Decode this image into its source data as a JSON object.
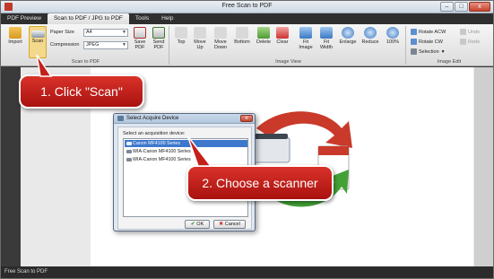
{
  "window": {
    "title": "Free Scan to PDF",
    "buttons": {
      "minimize": "–",
      "maximize": "□",
      "close": "x"
    }
  },
  "tabs": [
    {
      "label": "PDF Preview",
      "active": false
    },
    {
      "label": "Scan to PDF / JPG to PDF",
      "active": true
    },
    {
      "label": "Tools",
      "active": false
    },
    {
      "label": "Help",
      "active": false
    }
  ],
  "ribbon": {
    "scan_group": {
      "label": "Scan to PDF",
      "import_label": "Import",
      "scan_label": "Scan",
      "paper_size_label": "Paper Size",
      "paper_size_value": "A4",
      "compression_label": "Compression",
      "compression_value": "JPEG",
      "save_pdf_label": "Save PDF",
      "send_pdf_label": "Send PDF"
    },
    "image_view_group": {
      "label": "Image View",
      "top": "Top",
      "move_up": "Move Up",
      "move_down": "Move Down",
      "bottom": "Bottom",
      "delete": "Delete",
      "clear": "Clear",
      "fit_image": "Fit Image",
      "fit_width": "Fit Width",
      "enlarge": "Enlarge",
      "reduce": "Reduce",
      "percent": "100%"
    },
    "image_edit_group": {
      "label": "Image Edit",
      "rotate_acw": "Rotate ACW",
      "rotate_cw": "Rotate CW",
      "selection": "Selection",
      "undo": "Undo",
      "redo": "Redo"
    }
  },
  "dialog": {
    "title": "Select Acquire Device",
    "prompt": "Select an acquisition device:",
    "devices": [
      {
        "label": "Canon MF4100 Series",
        "selected": true
      },
      {
        "label": "WIA-Canon MF4100 Series",
        "selected": false
      },
      {
        "label": "WIA-Canon MF4100 Series",
        "selected": false
      }
    ],
    "ok_label": "OK",
    "cancel_label": "Cancel"
  },
  "callouts": {
    "step1": "1. Click \"Scan\"",
    "step2": "2. Choose a scanner"
  },
  "status": {
    "text": "Free Scan to PDF"
  },
  "colors": {
    "accent_red": "#c01d17",
    "selection_blue": "#3d78cc",
    "ribbon_active": "#f3d98b"
  }
}
